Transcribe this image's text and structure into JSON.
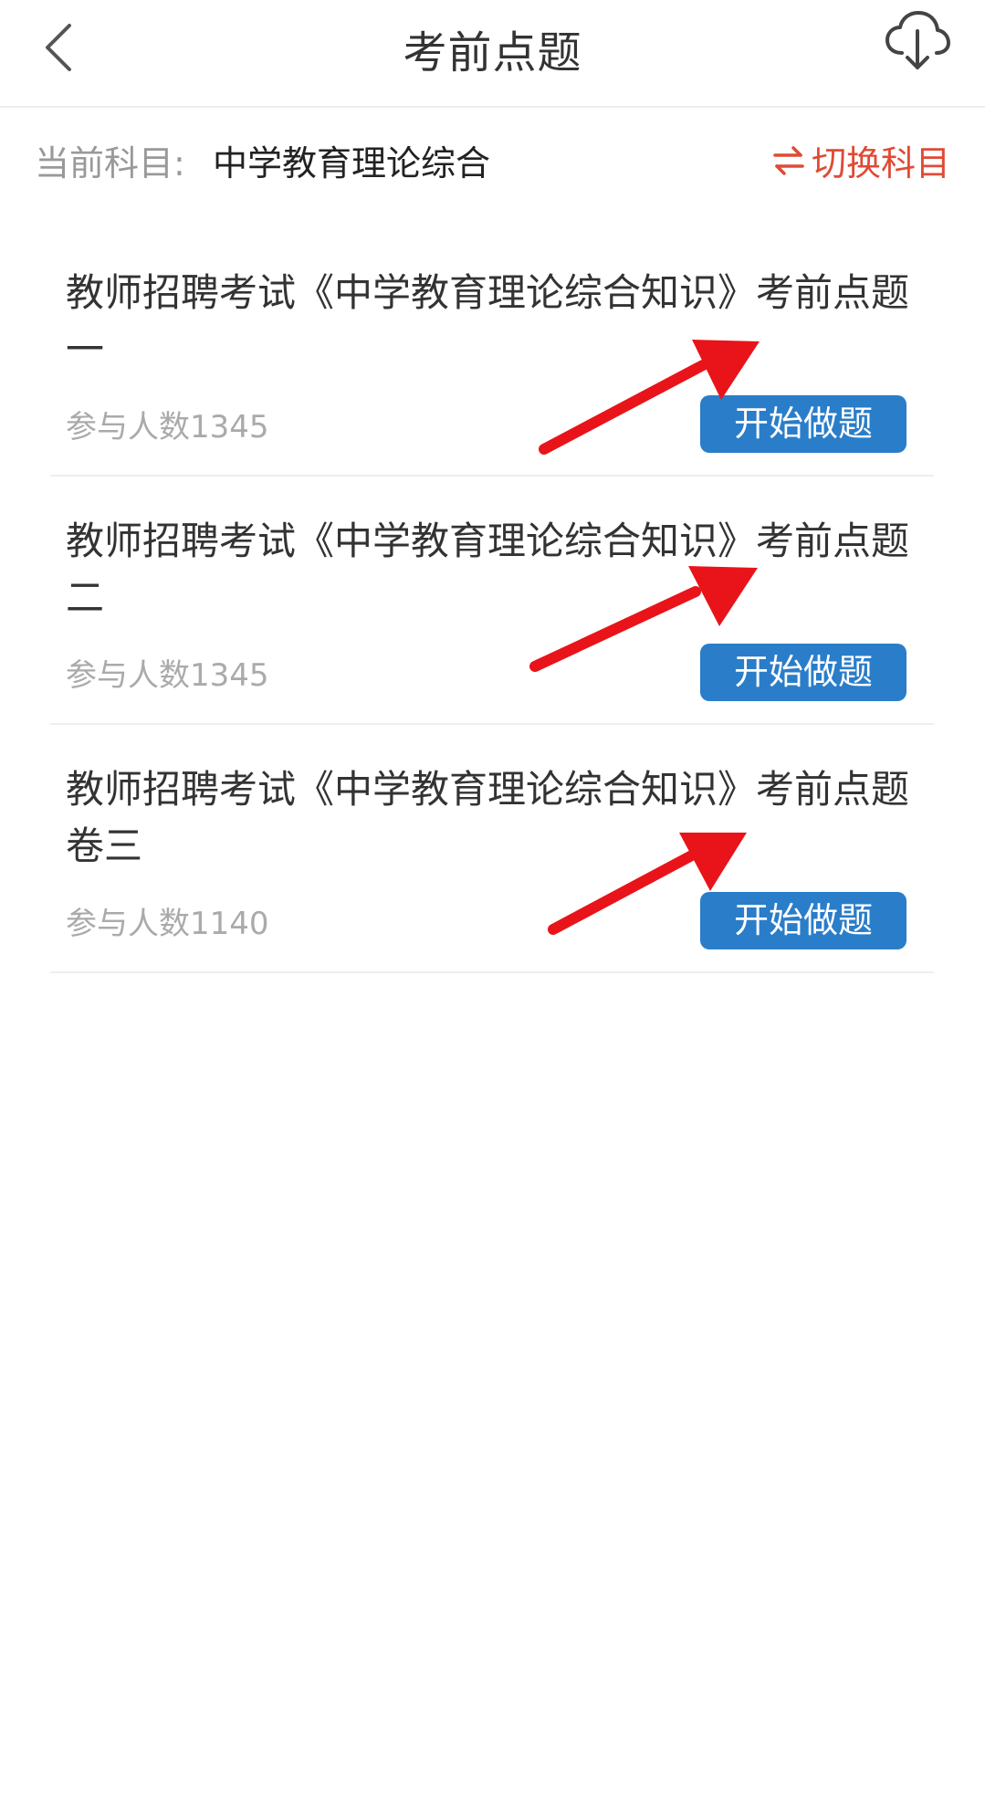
{
  "header": {
    "title": "考前点题",
    "back_icon": "chevron-left-icon",
    "download_icon": "cloud-download-icon"
  },
  "subject": {
    "label": "当前科目:",
    "value": "中学教育理论综合",
    "switch_label": "切换科目",
    "switch_icon": "swap-arrows-icon"
  },
  "items": [
    {
      "title": "教师招聘考试《中学教育理论综合知识》考前点题一",
      "count": "参与人数1345",
      "button": "开始做题"
    },
    {
      "title": "教师招聘考试《中学教育理论综合知识》考前点题二",
      "count": "参与人数1345",
      "button": "开始做题"
    },
    {
      "title": "教师招聘考试《中学教育理论综合知识》考前点题卷三",
      "count": "参与人数1140",
      "button": "开始做题"
    }
  ],
  "colors": {
    "accent": "#e04a35",
    "button_bg": "#2a7dc9",
    "annotation_arrow": "#e8141a"
  }
}
